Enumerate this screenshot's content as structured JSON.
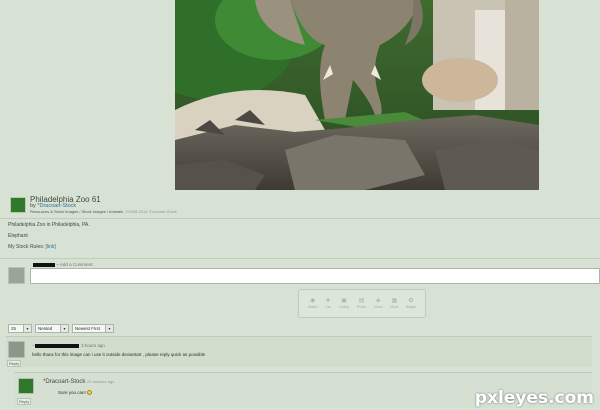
{
  "deviation": {
    "title": "Philadelphia Zoo 61",
    "by_prefix": "by",
    "author": "*Dracoart-Stock",
    "crumbs": "Resources & Stock Images / Stock Images / Animals",
    "crumbs_muted": "©2008-2014 *Dracoart-Stock",
    "thumb_icon": "deviation-thumbnail"
  },
  "description": {
    "line1": "Philadelphia Zoo in Philadelphia, PA.",
    "line2": "Elephant",
    "line3_prefix": "My Stock Rules:",
    "line3_link": "[link]"
  },
  "comment_form": {
    "add_comment_label": "Add a Comment:",
    "input_value": ""
  },
  "feedback": {
    "items": [
      {
        "icon": "watch-icon",
        "label": "Watch"
      },
      {
        "icon": "favourite-icon",
        "label": "Fav"
      },
      {
        "icon": "collect-icon",
        "label": "Collect"
      },
      {
        "icon": "print-icon",
        "label": "Prints"
      },
      {
        "icon": "share-icon",
        "label": "Share"
      },
      {
        "icon": "more-icon",
        "label": "More"
      },
      {
        "icon": "badge-icon",
        "label": "Badge"
      }
    ]
  },
  "sort": {
    "per_page": "25",
    "threading": "Nested",
    "order": "Newest First"
  },
  "comments": [
    {
      "author_redacted": true,
      "time": "3 hours ago",
      "text": "hello thanx for this image can i use it outside deviantart , please reply quick as possible",
      "reply_label": "Reply"
    },
    {
      "author": "*Dracoart-Stock",
      "time": "21 minutes ago",
      "text": "Sure you can!",
      "reply_label": "Reply"
    }
  ],
  "watermark": "pxleyes.com",
  "colors": {
    "background": "#d8e2d4",
    "link": "#2f6f8f",
    "accent_green": "#2f7a2a"
  }
}
